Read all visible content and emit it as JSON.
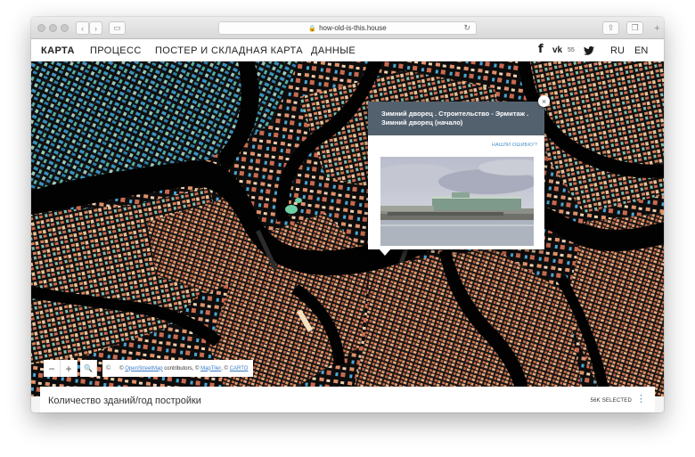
{
  "browser": {
    "url": "how-old-is-this.house",
    "back_glyph": "‹",
    "forward_glyph": "›",
    "sidebar_glyph": "▭",
    "share_glyph": "⇪",
    "tabs_glyph": "❐",
    "new_tab_glyph": "+",
    "reload_glyph": "↻",
    "lock_glyph": "🔒"
  },
  "nav": {
    "items": [
      "КАРТА",
      "ПРОЦЕСС",
      "ПОСТЕР И СКЛАДНАЯ КАРТА",
      "ДАННЫЕ"
    ],
    "active_index": 0,
    "facebook": "f",
    "vk": "vk",
    "vk_count": "55",
    "twitter": "🐦",
    "languages": [
      "RU",
      "EN"
    ]
  },
  "popup": {
    "title": "Зимний дворец . Строительство - Эрмитаж . Зимний дворец (начало)",
    "report_link": "НАШЛИ ОШИБКУ?",
    "close_glyph": "×"
  },
  "map_controls": {
    "zoom_out": "−",
    "zoom_in": "+",
    "search_glyph": "🔍",
    "info_glyph": "©",
    "attribution_prefix": "©",
    "attribution_osm": "OpenStreetMap",
    "attribution_mid": "contributors, ©",
    "attribution_maptiler": "MapTiler",
    "attribution_sep": ", ©",
    "attribution_carto": "CARTO"
  },
  "panel": {
    "title": "Количество зданий/год постройки",
    "selected": "56K SELECTED",
    "menu_glyph": "⋮"
  },
  "colors": {
    "map_background": "#0c0c0c",
    "popup_header": "#53616e",
    "link": "#4a90c2",
    "building_old": "#e0855a",
    "building_new": "#3fa9d8"
  }
}
